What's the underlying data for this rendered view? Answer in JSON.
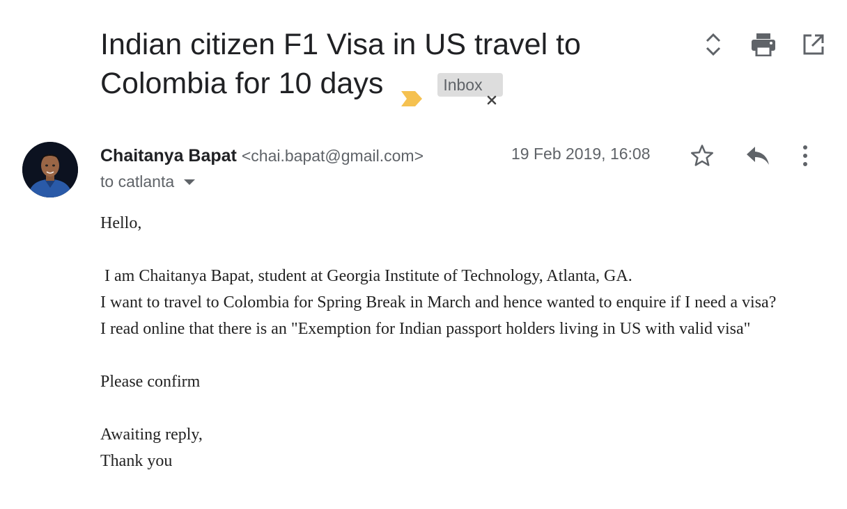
{
  "subject": {
    "line1": "Indian citizen F1 Visa in US travel to",
    "line2": "Colombia for 10 days",
    "label": "Inbox",
    "marker_color": "#f5c150"
  },
  "toolbar": {
    "icons": [
      "expand-collapse-icon",
      "print-icon",
      "open-in-new-window-icon"
    ]
  },
  "message": {
    "sender_name": "Chaitanya Bapat",
    "sender_email": "<chai.bapat@gmail.com>",
    "recipient": "to catlanta",
    "date": "19 Feb 2019, 16:08",
    "action_icons": [
      "star-icon",
      "reply-icon",
      "more-vertical-icon"
    ],
    "body": {
      "greeting": "Hello,",
      "line1": " I am Chaitanya Bapat, student at Georgia Institute of Technology, Atlanta, GA.",
      "line2": "I want to travel to Colombia for Spring Break in March and hence wanted to enquire if I need a visa?",
      "line3": "I read online that there is an \"Exemption for Indian passport holders living in US with valid visa\"",
      "confirm": "Please confirm",
      "awaiting": "Awaiting reply,",
      "thanks": "Thank you"
    }
  }
}
